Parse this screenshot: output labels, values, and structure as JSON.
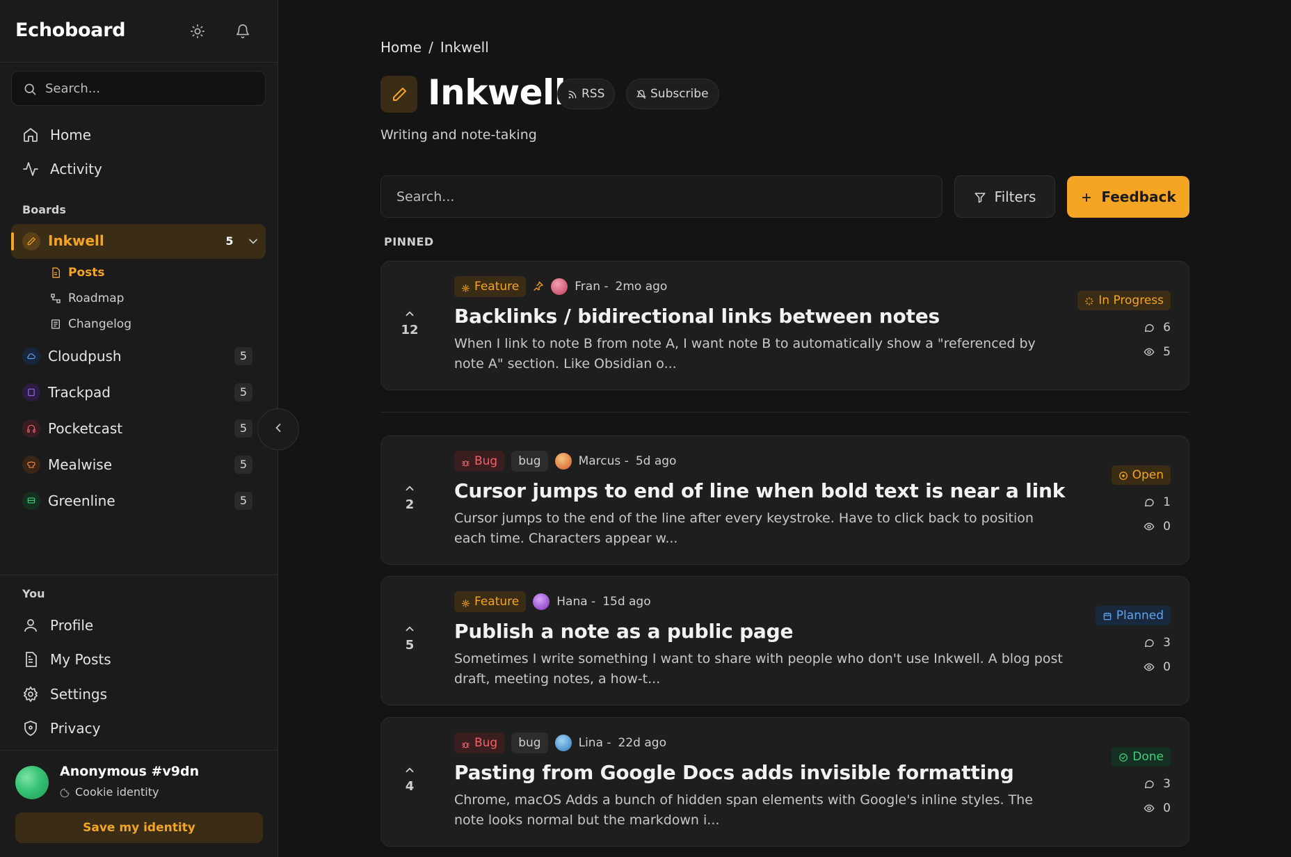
{
  "app": {
    "brand": "Echoboard"
  },
  "sidebar": {
    "search_placeholder": "Search...",
    "nav": [
      {
        "label": "Home",
        "icon": "home-icon"
      },
      {
        "label": "Activity",
        "icon": "activity-icon"
      }
    ],
    "boards_label": "Boards",
    "active_board": {
      "name": "Inkwell",
      "count": "5",
      "subitems": [
        {
          "label": "Posts"
        },
        {
          "label": "Roadmap"
        },
        {
          "label": "Changelog"
        }
      ]
    },
    "boards": [
      {
        "name": "Cloudpush",
        "count": "5",
        "color": "#5ea3f0"
      },
      {
        "name": "Trackpad",
        "count": "5",
        "color": "#9b6cf0"
      },
      {
        "name": "Pocketcast",
        "count": "5",
        "color": "#f0626a"
      },
      {
        "name": "Mealwise",
        "count": "5",
        "color": "#f08a3a"
      },
      {
        "name": "Greenline",
        "count": "5",
        "color": "#3fcf7c"
      }
    ],
    "you_label": "You",
    "you_items": [
      {
        "label": "Profile"
      },
      {
        "label": "My Posts"
      },
      {
        "label": "Settings"
      },
      {
        "label": "Privacy"
      }
    ],
    "user": {
      "name": "Anonymous #v9dn",
      "identity": "Cookie identity",
      "save_label": "Save my identity"
    }
  },
  "main": {
    "breadcrumb": {
      "home": "Home",
      "sep": "/",
      "current": "Inkwell"
    },
    "title": "Inkwell",
    "rss_label": "RSS",
    "subscribe_label": "Subscribe",
    "subtitle": "Writing and note-taking",
    "search_placeholder": "Search...",
    "filters_label": "Filters",
    "feedback_label": "Feedback",
    "pinned_label": "PINNED"
  },
  "posts": [
    {
      "votes": "12",
      "type": "Feature",
      "extra_tag": "",
      "pinned": true,
      "author": "Fran -",
      "time": "2mo ago",
      "title": "Backlinks / bidirectional links between notes",
      "body": "When I link to note B from note A, I want note B to automatically show a \"referenced by note A\" section. Like Obsidian o...",
      "status": "In Progress",
      "comments": "6",
      "views": "5"
    },
    {
      "votes": "2",
      "type": "Bug",
      "extra_tag": "bug",
      "pinned": false,
      "author": "Marcus -",
      "time": "5d ago",
      "title": "Cursor jumps to end of line when bold text is near a link",
      "body": "Cursor jumps to the end of the line after every keystroke. Have to click back to position each time. Characters appear w...",
      "status": "Open",
      "comments": "1",
      "views": "0"
    },
    {
      "votes": "5",
      "type": "Feature",
      "extra_tag": "",
      "pinned": false,
      "author": "Hana -",
      "time": "15d ago",
      "title": "Publish a note as a public page",
      "body": "Sometimes I write something I want to share with people who don't use Inkwell. A blog post draft, meeting notes, a how-t...",
      "status": "Planned",
      "comments": "3",
      "views": "0"
    },
    {
      "votes": "4",
      "type": "Bug",
      "extra_tag": "bug",
      "pinned": false,
      "author": "Lina -",
      "time": "22d ago",
      "title": "Pasting from Google Docs adds invisible formatting",
      "body": "Chrome, macOS Adds a bunch of hidden span elements with Google's inline styles. The note looks normal but the markdown i...",
      "status": "Done",
      "comments": "3",
      "views": "0"
    }
  ],
  "colors": {
    "accent": "#f5a524",
    "background": "#141414",
    "sidebar": "#1b1b1b",
    "card": "#1e1e1e"
  }
}
